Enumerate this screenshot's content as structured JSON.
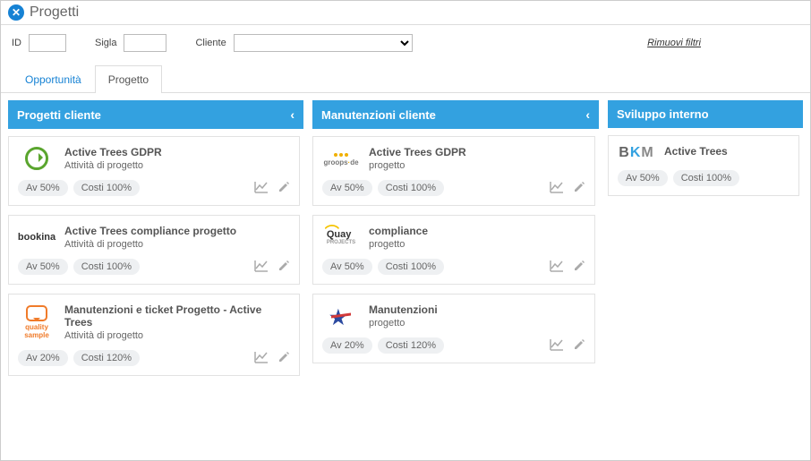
{
  "header": {
    "title": "Progetti"
  },
  "filters": {
    "id_label": "ID",
    "sigla_label": "Sigla",
    "cliente_label": "Cliente",
    "remove_label": "Rimuovi filtri"
  },
  "tabs": [
    {
      "label": "Opportunità"
    },
    {
      "label": "Progetto"
    }
  ],
  "columns": [
    {
      "title": "Progetti cliente",
      "collapsible": true,
      "cards": [
        {
          "logo": "green-circle",
          "title": "Active Trees GDPR",
          "subtitle": "Attività di progetto",
          "av": "Av 50%",
          "costi": "Costi 100%",
          "actions": true
        },
        {
          "logo": "bookina",
          "title": "Active Trees compliance progetto",
          "subtitle": "Attività di progetto",
          "av": "Av 50%",
          "costi": "Costi 100%",
          "actions": true
        },
        {
          "logo": "quality-sample",
          "title": "Manutenzioni e ticket Progetto - Active Trees",
          "subtitle": "Attività di progetto",
          "av": "Av 20%",
          "costi": "Costi 120%",
          "actions": true
        }
      ]
    },
    {
      "title": "Manutenzioni cliente",
      "collapsible": true,
      "cards": [
        {
          "logo": "groops",
          "title": "Active Trees GDPR",
          "subtitle": "progetto",
          "av": "Av 50%",
          "costi": "Costi 100%",
          "actions": true
        },
        {
          "logo": "quay",
          "title": "compliance",
          "subtitle": "progetto",
          "av": "Av 50%",
          "costi": "Costi 100%",
          "actions": true
        },
        {
          "logo": "star",
          "title": "Manutenzioni",
          "subtitle": "progetto",
          "av": "Av 20%",
          "costi": "Costi 120%",
          "actions": true
        }
      ]
    },
    {
      "title": "Sviluppo interno",
      "collapsible": false,
      "cards": [
        {
          "logo": "bkm",
          "title": "Active Trees",
          "subtitle": "",
          "av": "Av 50%",
          "costi": "Costi 100%",
          "actions": false
        }
      ]
    }
  ]
}
